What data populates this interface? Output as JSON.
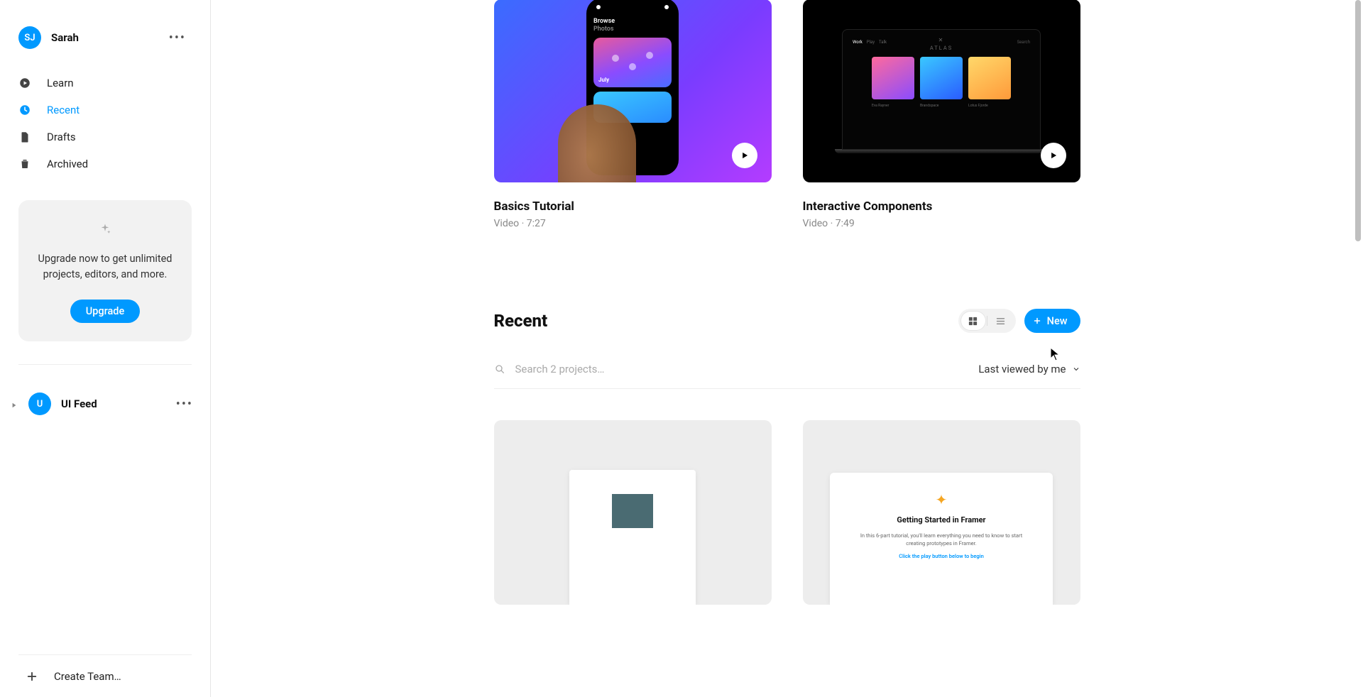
{
  "colors": {
    "accent": "#0099ff",
    "avatar1": "#0099ff",
    "avatar2": "#0099ff",
    "sparkle": "#aaa"
  },
  "user": {
    "initials": "SJ",
    "name": "Sarah"
  },
  "nav": {
    "learn": "Learn",
    "recent": "Recent",
    "drafts": "Drafts",
    "archived": "Archived"
  },
  "upgrade": {
    "text": "Upgrade now to get unlimited projects, editors, and more.",
    "button": "Upgrade"
  },
  "team": {
    "initial": "U",
    "name": "UI Feed"
  },
  "create_team": "Create Team…",
  "videos": [
    {
      "title": "Basics Tutorial",
      "meta": "Video · 7:27",
      "phone_title": "Browse",
      "phone_sub": "Photos",
      "tag": "July"
    },
    {
      "title": "Interactive Components",
      "meta": "Video · 7:49",
      "brand": "ATLAS",
      "nav": [
        "Work",
        "Play",
        "Talk"
      ],
      "search": "Search",
      "caps": [
        "Eva Rayner",
        "Brandspace",
        "Lotus Fjorde"
      ]
    }
  ],
  "section": {
    "title": "Recent",
    "new": "New",
    "search_placeholder": "Search 2 projects…",
    "sort": "Last viewed by me"
  },
  "project2": {
    "title": "Getting Started in Framer",
    "desc": "In this 6-part tutorial, you'll learn everything you need to know to start creating prototypes in Framer.",
    "link": "Click the play button below to begin"
  }
}
